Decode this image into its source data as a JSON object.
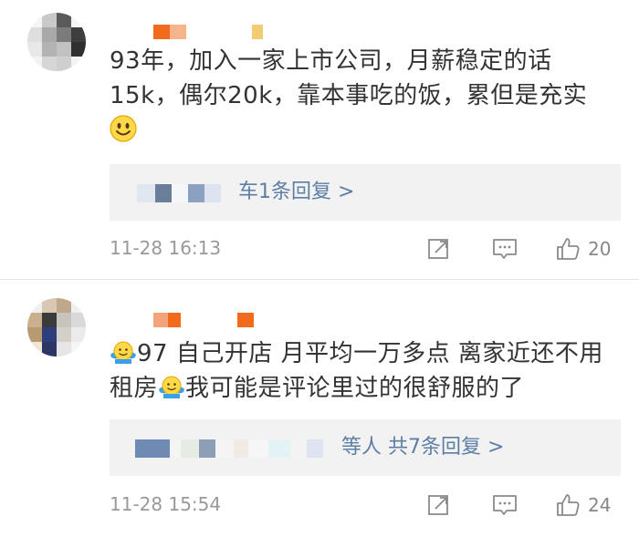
{
  "comments": [
    {
      "text_parts": [
        "93年，加入一家上市公司，月薪稳定的话15k，偶尔20k，靠本事吃的饭，累但是充实"
      ],
      "emoji_after_text": "smile-emoji",
      "reply_summary": "共1条回复 >",
      "reply_summary_visible": "车1条回复 >",
      "time": "11-28 16:13",
      "likes": "20"
    },
    {
      "text_a": "97 自己开店 月平均一万多点 离家近还不用租房",
      "text_b": "我可能是评论里过的很舒服的了",
      "emoji": "shrug-emoji",
      "reply_summary": "等人 共7条回复 >",
      "time": "11-28 15:54",
      "likes": "24"
    }
  ],
  "icons": {
    "share": "share-icon",
    "comment": "comment-icon",
    "like": "thumbs-up-icon"
  },
  "colors": {
    "link": "#5d7fa5",
    "meta": "#999999",
    "reply_bg": "#f2f2f2",
    "username_orange": "#f26a1b"
  }
}
